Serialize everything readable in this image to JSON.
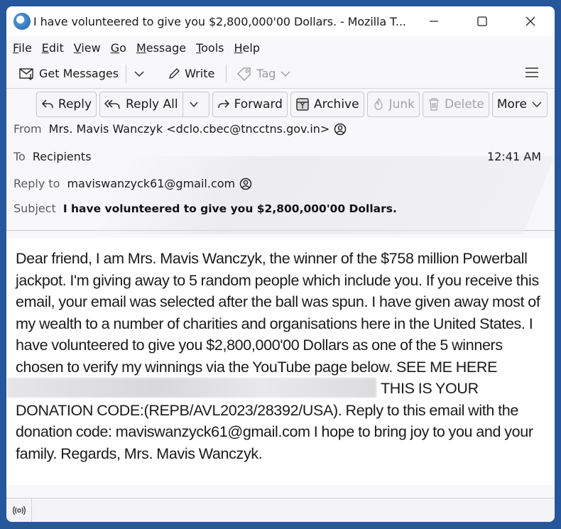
{
  "window": {
    "title": "I have volunteered to give you $2,800,000'00 Dollars. - Mozilla T...",
    "app_icon": "thunderbird-logo",
    "controls": [
      "minimize",
      "maximize",
      "close"
    ]
  },
  "menu": [
    {
      "label": "File",
      "accel": "F",
      "rest": "ile"
    },
    {
      "label": "Edit",
      "accel": "E",
      "rest": "dit"
    },
    {
      "label": "View",
      "accel": "V",
      "rest": "iew"
    },
    {
      "label": "Go",
      "accel": "G",
      "rest": "o"
    },
    {
      "label": "Message",
      "accel": "M",
      "rest": "essage"
    },
    {
      "label": "Tools",
      "accel": "T",
      "rest": "ools"
    },
    {
      "label": "Help",
      "accel": "H",
      "rest": "elp"
    }
  ],
  "toolbar": {
    "get_messages": "Get Messages",
    "write": "Write",
    "tag": "Tag"
  },
  "message_buttons": {
    "reply": "Reply",
    "reply_all": "Reply All",
    "forward": "Forward",
    "archive": "Archive",
    "junk": "Junk",
    "delete": "Delete",
    "more": "More"
  },
  "header": {
    "from_label": "From",
    "from_value": "Mrs. Mavis Wanczyk <dclo.cbec@tncctns.gov.in>",
    "to_label": "To",
    "to_value": "Recipients",
    "time": "12:41 AM",
    "reply_to_label": "Reply to",
    "reply_to_value": "maviswanzyck61@gmail.com",
    "subject_label": "Subject",
    "subject_value": "I have volunteered to give you $2,800,000'00 Dollars."
  },
  "body": {
    "part1": "Dear friend, I am Mrs. Mavis Wanczyk, the winner of the $758 million Powerball jackpot. I'm giving away to 5 random people which include you. If you receive this email, your email was selected after the ball was spun. I have given away most of my wealth to a number of charities and organisations here in the United States. I have volunteered to give you $2,800,000'00 Dollars as one of the 5 winners chosen to verify my winnings via the YouTube page below. SEE ME HERE",
    "redacted_link": "[redacted link]",
    "part2": "THIS IS YOUR DONATION CODE:(REPB/AVL2023/28392/USA). Reply to this email with the donation code: maviswanzyck61@gmail.com I hope to bring joy to you and your family. Regards, Mrs. Mavis Wanczyk."
  },
  "colors": {
    "desktop": "#25579a",
    "window_bg": "#f8f8fa",
    "body_bg": "#ffffff"
  }
}
